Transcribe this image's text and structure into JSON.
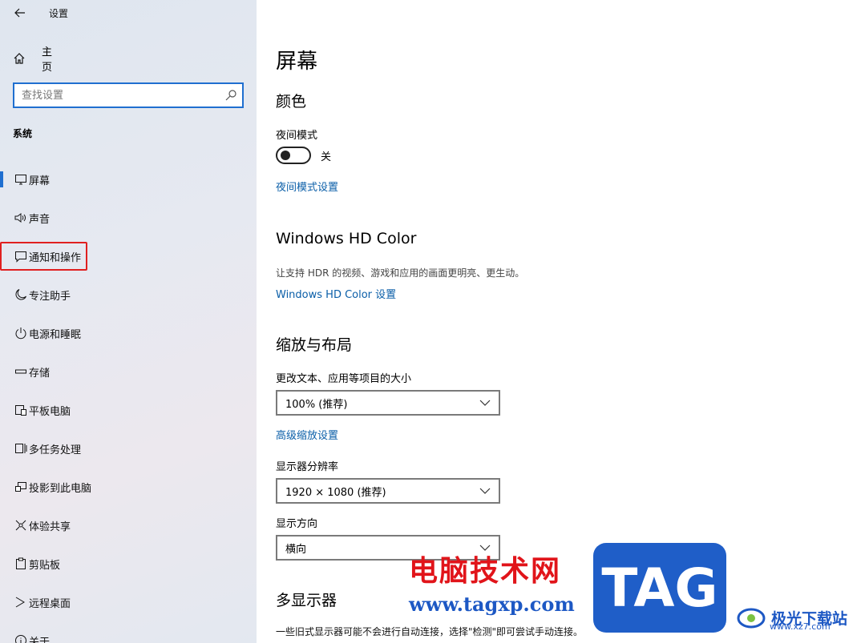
{
  "window": {
    "title": "设置"
  },
  "sidebar": {
    "home_label": "主页",
    "search_placeholder": "查找设置",
    "section_label": "系统",
    "items": [
      {
        "label": "屏幕",
        "icon": "monitor-icon",
        "selected": true
      },
      {
        "label": "声音",
        "icon": "speaker-icon"
      },
      {
        "label": "通知和操作",
        "icon": "message-icon",
        "highlighted": true
      },
      {
        "label": "专注助手",
        "icon": "moon-icon"
      },
      {
        "label": "电源和睡眠",
        "icon": "power-icon"
      },
      {
        "label": "存储",
        "icon": "storage-icon"
      },
      {
        "label": "平板电脑",
        "icon": "tablet-icon"
      },
      {
        "label": "多任务处理",
        "icon": "multitask-icon"
      },
      {
        "label": "投影到此电脑",
        "icon": "project-icon"
      },
      {
        "label": "体验共享",
        "icon": "share-icon"
      },
      {
        "label": "剪贴板",
        "icon": "clipboard-icon"
      },
      {
        "label": "远程桌面",
        "icon": "remote-icon"
      },
      {
        "label": "关于",
        "icon": "info-icon"
      }
    ]
  },
  "main": {
    "title": "屏幕",
    "color_heading": "颜色",
    "night_light_label": "夜间模式",
    "night_light_state": "关",
    "night_light_link": "夜间模式设置",
    "hdr_heading": "Windows HD Color",
    "hdr_desc": "让支持 HDR 的视频、游戏和应用的画面更明亮、更生动。",
    "hdr_link": "Windows HD Color 设置",
    "scale_heading": "缩放与布局",
    "scale_label": "更改文本、应用等项目的大小",
    "scale_value": "100% (推荐)",
    "advanced_scale_link": "高级缩放设置",
    "resolution_label": "显示器分辨率",
    "resolution_value": "1920 × 1080 (推荐)",
    "orientation_label": "显示方向",
    "orientation_value": "横向",
    "multi_heading": "多显示器",
    "multi_desc": "一些旧式显示器可能不会进行自动连接，选择\"检测\"即可尝试手动连接。"
  },
  "watermark": {
    "text": "电脑技术网",
    "url": "www.tagxp.com",
    "tag": "TAG",
    "site_name": "极光下载站",
    "site_url": "www.xz7.com"
  },
  "colors": {
    "accent": "#1f6fd0",
    "link": "#0a5ea8",
    "highlight": "#e02020"
  }
}
